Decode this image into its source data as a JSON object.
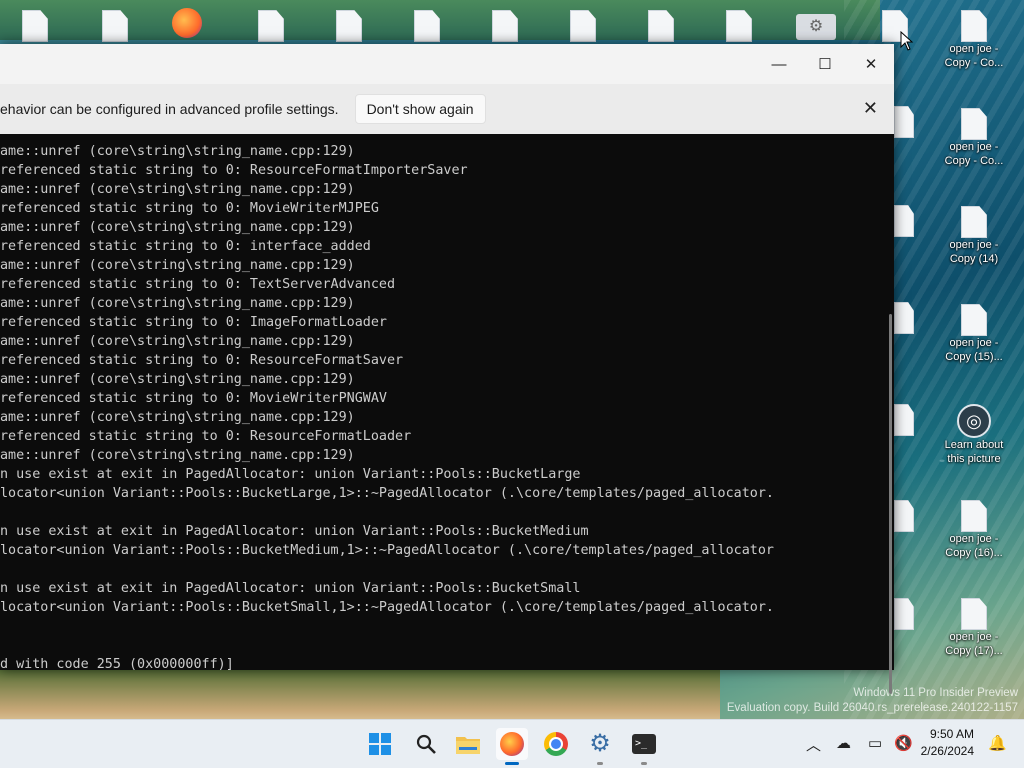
{
  "desktop": {
    "right_icons": [
      {
        "label_1": "open joe -",
        "label_2": "Copy - Co..."
      },
      {
        "label_1": "open joe -",
        "label_2": "Copy - Co..."
      },
      {
        "label_1": "open joe -",
        "label_2": "Copy (14)"
      },
      {
        "label_1": "open joe -",
        "label_2": "Copy (15)..."
      },
      {
        "label_1": "Learn about",
        "label_2": "this picture"
      },
      {
        "label_1": "open joe -",
        "label_2": "Copy (16)..."
      },
      {
        "label_1": "open joe -",
        "label_2": "Copy (17)..."
      }
    ],
    "watermark_line1": "Windows 11 Pro Insider Preview",
    "watermark_line2": "Evaluation copy. Build 26040.rs_prerelease.240122-1157"
  },
  "window": {
    "minimize_glyph": "—",
    "maximize_glyph": "☐",
    "close_glyph": "✕",
    "infobar": {
      "text": "ehavior can be configured in advanced profile settings.",
      "button": "Don't show again",
      "close_glyph": "✕"
    },
    "terminal_lines": [
      "ame::unref (core\\string\\string_name.cpp:129)",
      "referenced static string to 0: ResourceFormatImporterSaver",
      "ame::unref (core\\string\\string_name.cpp:129)",
      "referenced static string to 0: MovieWriterMJPEG",
      "ame::unref (core\\string\\string_name.cpp:129)",
      "referenced static string to 0: interface_added",
      "ame::unref (core\\string\\string_name.cpp:129)",
      "referenced static string to 0: TextServerAdvanced",
      "ame::unref (core\\string\\string_name.cpp:129)",
      "referenced static string to 0: ImageFormatLoader",
      "ame::unref (core\\string\\string_name.cpp:129)",
      "referenced static string to 0: ResourceFormatSaver",
      "ame::unref (core\\string\\string_name.cpp:129)",
      "referenced static string to 0: MovieWriterPNGWAV",
      "ame::unref (core\\string\\string_name.cpp:129)",
      "referenced static string to 0: ResourceFormatLoader",
      "ame::unref (core\\string\\string_name.cpp:129)",
      "n use exist at exit in PagedAllocator: union Variant::Pools::BucketLarge",
      "locator<union Variant::Pools::BucketLarge,1>::~PagedAllocator (.\\core/templates/paged_allocator.",
      "",
      "n use exist at exit in PagedAllocator: union Variant::Pools::BucketMedium",
      "locator<union Variant::Pools::BucketMedium,1>::~PagedAllocator (.\\core/templates/paged_allocator",
      "",
      "n use exist at exit in PagedAllocator: union Variant::Pools::BucketSmall",
      "locator<union Variant::Pools::BucketSmall,1>::~PagedAllocator (.\\core/templates/paged_allocator.",
      "",
      "",
      "d with code 255 (0x000000ff)]"
    ]
  },
  "taskbar": {
    "clock_time": "9:50 AM",
    "clock_date": "2/26/2024"
  }
}
